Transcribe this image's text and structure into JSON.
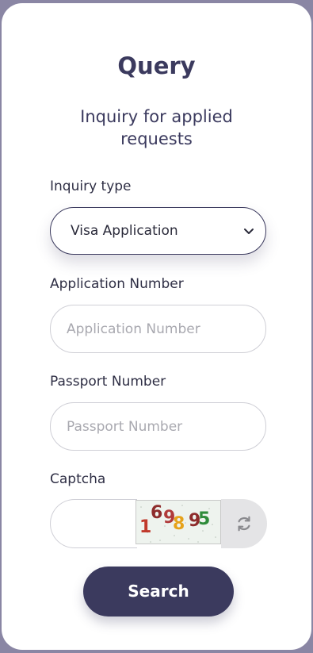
{
  "form": {
    "title": "Query",
    "subtitle": "Inquiry for applied requests",
    "inquiry_type_label": "Inquiry type",
    "inquiry_type_value": "Visa Application",
    "application_number_label": "Application Number",
    "application_number_placeholder": "Application Number",
    "passport_number_label": "Passport Number",
    "passport_number_placeholder": "Passport Number",
    "captcha_label": "Captcha",
    "captcha_code": "169895",
    "captcha_value": "",
    "search_label": "Search",
    "refresh_icon": "refresh-icon",
    "dropdown_icon": "chevron-down-icon"
  }
}
